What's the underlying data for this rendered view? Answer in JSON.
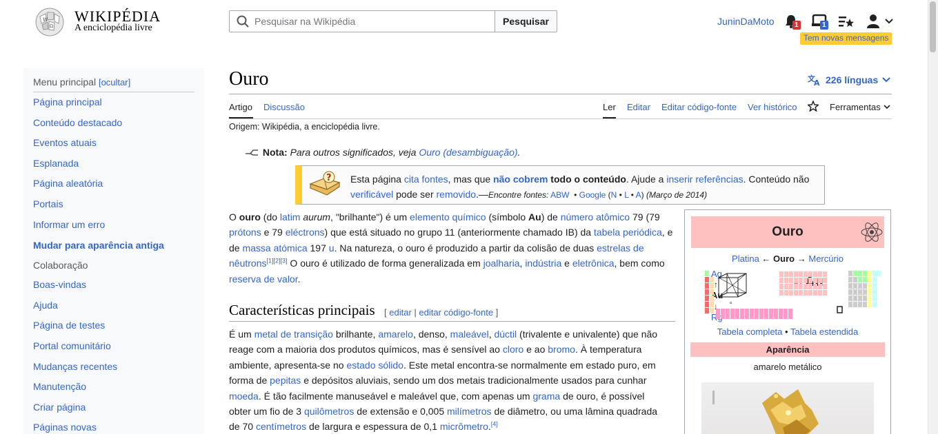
{
  "header": {
    "logo_word": "WIKIPÉDIA",
    "logo_tagline": "A enciclopédia livre",
    "search_placeholder": "Pesquisar na Wikipédia",
    "search_button": "Pesquisar",
    "username": "JuninDaMoto",
    "notifications_count": "1",
    "notices_count": "1",
    "new_messages": "Tem novas mensagens",
    "icons": [
      "bell-icon",
      "tray-icon",
      "watchlist-icon",
      "user-icon",
      "chevron-down-icon"
    ]
  },
  "sidebar": {
    "menu_title": "Menu principal",
    "hide_label": "[ocultar]",
    "items": [
      {
        "label": "Página principal"
      },
      {
        "label": "Conteúdo destacado"
      },
      {
        "label": "Eventos atuais"
      },
      {
        "label": "Esplanada"
      },
      {
        "label": "Página aleatória"
      },
      {
        "label": "Portais"
      },
      {
        "label": "Informar um erro"
      },
      {
        "label": "Mudar para aparência antiga"
      },
      {
        "label": "Colaboração"
      },
      {
        "label": "Boas-vindas"
      },
      {
        "label": "Ajuda"
      },
      {
        "label": "Página de testes"
      },
      {
        "label": "Portal comunitário"
      },
      {
        "label": "Mudanças recentes"
      },
      {
        "label": "Manutenção"
      },
      {
        "label": "Criar página"
      },
      {
        "label": "Páginas novas"
      }
    ]
  },
  "page": {
    "title": "Ouro",
    "languages": "226 línguas",
    "tabs": {
      "article": "Artigo",
      "talk": "Discussão",
      "read": "Ler",
      "edit": "Editar",
      "edit_source": "Editar código-fonte",
      "history": "Ver histórico",
      "tools": "Ferramentas"
    },
    "origin": "Origem: Wikipédia, a enciclopédia livre."
  },
  "hatnote": {
    "label": "Nota:",
    "text": "Para outros significados, veja",
    "link": "Ouro (desambiguação)",
    "end": "."
  },
  "ambox": {
    "t1": "Esta página",
    "l1": "cita fontes",
    "t2": ", mas que",
    "l2": "não cobrem",
    "t3": "todo o conteúdo",
    "t4": ". Ajude a",
    "l3": "inserir referências",
    "t5": ". Conteúdo não",
    "l4": "verificável",
    "t6": "pode ser",
    "l5": "removido",
    "t7": ".—",
    "find": "Encontre fontes:",
    "s1": "ABW",
    "s2": "Google",
    "s3": "N",
    "s4": "L",
    "s5": "A",
    "date": "(Março de 2014)"
  },
  "intro": {
    "a1": "O",
    "b1": "ouro",
    "a2": "(do",
    "l1": "latim",
    "i1": "aurum",
    "a3": ", \"brilhante\") é um",
    "l2": "elemento químico",
    "a4": "(símbolo",
    "b2": "Au",
    "a5": ") de",
    "l3": "número atômico",
    "a6": "79 (79",
    "l4": "prótons",
    "a7": "e 79",
    "l5": "eléctrons",
    "a8": ") que está situado no grupo 11 (anteriormente chamado IB) da",
    "l6": "tabela periódica",
    "a9": ", e de",
    "l7": "massa atómica",
    "a10": "197",
    "l8": "u",
    "a11": ". Na natureza, o ouro é produzido a partir da colisão de duas",
    "l9": "estrelas de nêutrons",
    "r1": "[1]",
    "r2": "[2]",
    "r3": "[3]",
    "a12": "O ouro é utilizado de forma generalizada em",
    "l10": "joalharia",
    "a13": ",",
    "l11": "indústria",
    "a14": "e",
    "l12": "eletrônica",
    "a15": ", bem como",
    "l13": "reserva de valor",
    "a16": "."
  },
  "section": {
    "heading": "Características principais",
    "edit_open": "[",
    "edit": "editar",
    "sep": "|",
    "edit_source": "editar código-fonte",
    "edit_close": "]"
  },
  "char": {
    "a1": "É um",
    "l1": "metal de transição",
    "a2": "brilhante,",
    "l2": "amarelo",
    "a3": ", denso,",
    "l3": "maleável",
    "a4": ",",
    "l4": "dúctil",
    "a5": "(trivalente e univalente) que não reage com a maioria dos produtos químicos, mas é sensível ao",
    "l5": "cloro",
    "a6": "e ao",
    "l6": "bromo",
    "a7": ". À temperatura ambiente, apresenta-se no",
    "l7": "estado sólido",
    "a8": ". Este metal encontra-se normalmente em estado puro, em forma de",
    "l8": "pepitas",
    "a9": "e depósitos aluviais, sendo um dos metais tradicionalmente usados para cunhar",
    "l9": "moeda",
    "a10": ". É tão facilmente manuseável e maleável que, com apenas um",
    "l10": "grama",
    "a11": "de ouro, é possível obter um fio de 3",
    "l11": "quilômetros",
    "a12": "de extensão e 0,005",
    "l12": "milímetros",
    "a13": "de diâmetro, ou uma lâmina quadrada de 70",
    "l13": "centímetros",
    "a14": "de largura e espessura de 0,1",
    "l14": "micrômetro",
    "a15": ".",
    "r4": "[4]"
  },
  "infobox": {
    "title": "Ouro",
    "prev": "Platina",
    "arrow_left": "←",
    "current": "Ouro",
    "arrow_right": "→",
    "next": "Mercúrio",
    "above": "Ag",
    "up_arrow": "↑",
    "symbol_mid": "Au",
    "down_arrow": "↓",
    "below": "Rg",
    "atomic_number": "79",
    "symbol": "Au",
    "table_full": "Tabela completa",
    "bullet": "•",
    "table_extended": "Tabela estendida",
    "appearance_header": "Aparência",
    "appearance": "amarelo metálico"
  },
  "colors": {
    "link": "#3366cc",
    "infobox_header": "#ffc0c0",
    "ambox_stripe": "#ffcc33",
    "new_messages_bg": "#ffcc33",
    "badge_red": "#d73333",
    "badge_blue": "#3366cc"
  }
}
